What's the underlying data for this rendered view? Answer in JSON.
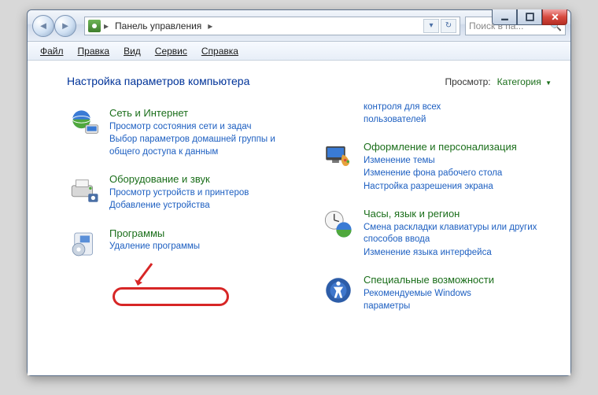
{
  "breadcrumb": {
    "item": "Панель управления"
  },
  "search": {
    "placeholder": "Поиск в па..."
  },
  "menu": {
    "file": "Файл",
    "edit": "Правка",
    "view": "Вид",
    "tools": "Сервис",
    "help": "Справка"
  },
  "main": {
    "title": "Настройка параметров компьютера",
    "view_label": "Просмотр:",
    "view_value": "Категория"
  },
  "left": {
    "net": {
      "title": "Сеть и Интернет",
      "l1": "Просмотр состояния сети и задач",
      "l2": "Выбор параметров домашней группы и общего доступа к данным"
    },
    "hw": {
      "title": "Оборудование и звук",
      "l1": "Просмотр устройств и принтеров",
      "l2": "Добавление устройства"
    },
    "prog": {
      "title": "Программы",
      "l1": "Удаление программы"
    }
  },
  "right": {
    "extra": {
      "l1": "контроля для всех",
      "l2": "пользователей"
    },
    "pers": {
      "title": "Оформление и персонализация",
      "l1": "Изменение темы",
      "l2": "Изменение фона рабочего стола",
      "l3": "Настройка разрешения экрана"
    },
    "clock": {
      "title": "Часы, язык и регион",
      "l1": "Смена раскладки клавиатуры или других способов ввода",
      "l2": "Изменение языка интерфейса"
    },
    "ease": {
      "title": "Специальные возможности",
      "l1": "Рекомендуемые Windows",
      "l2": "параметры"
    }
  }
}
